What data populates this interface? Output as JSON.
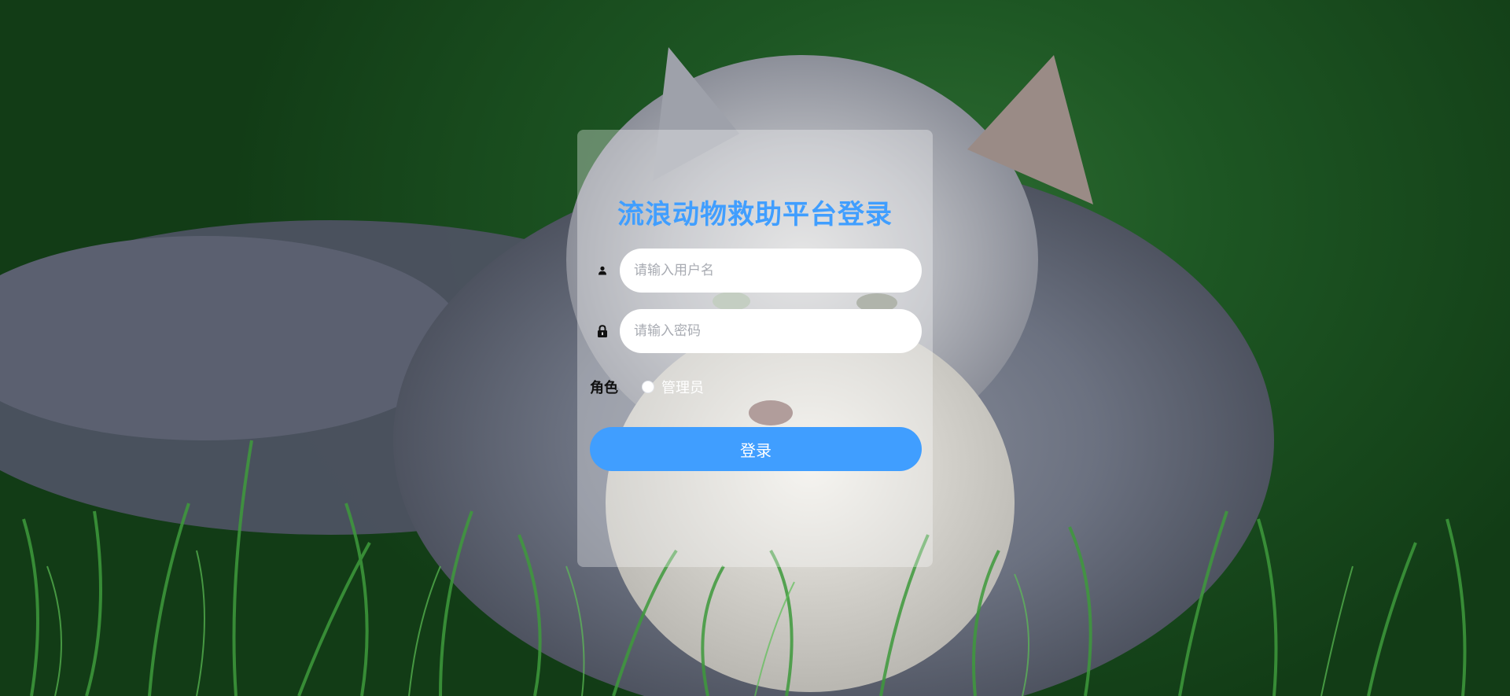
{
  "login": {
    "title": "流浪动物救助平台登录",
    "username": {
      "value": "",
      "placeholder": "请输入用户名",
      "icon": "user-icon"
    },
    "password": {
      "value": "",
      "placeholder": "请输入密码",
      "icon": "lock-icon"
    },
    "role": {
      "label": "角色",
      "options": [
        {
          "label": "管理员",
          "selected": false
        }
      ]
    },
    "submit_label": "登录"
  },
  "colors": {
    "accent": "#409eff",
    "card_overlay": "rgba(255,255,255,0.33)",
    "input_bg": "#ffffff"
  }
}
